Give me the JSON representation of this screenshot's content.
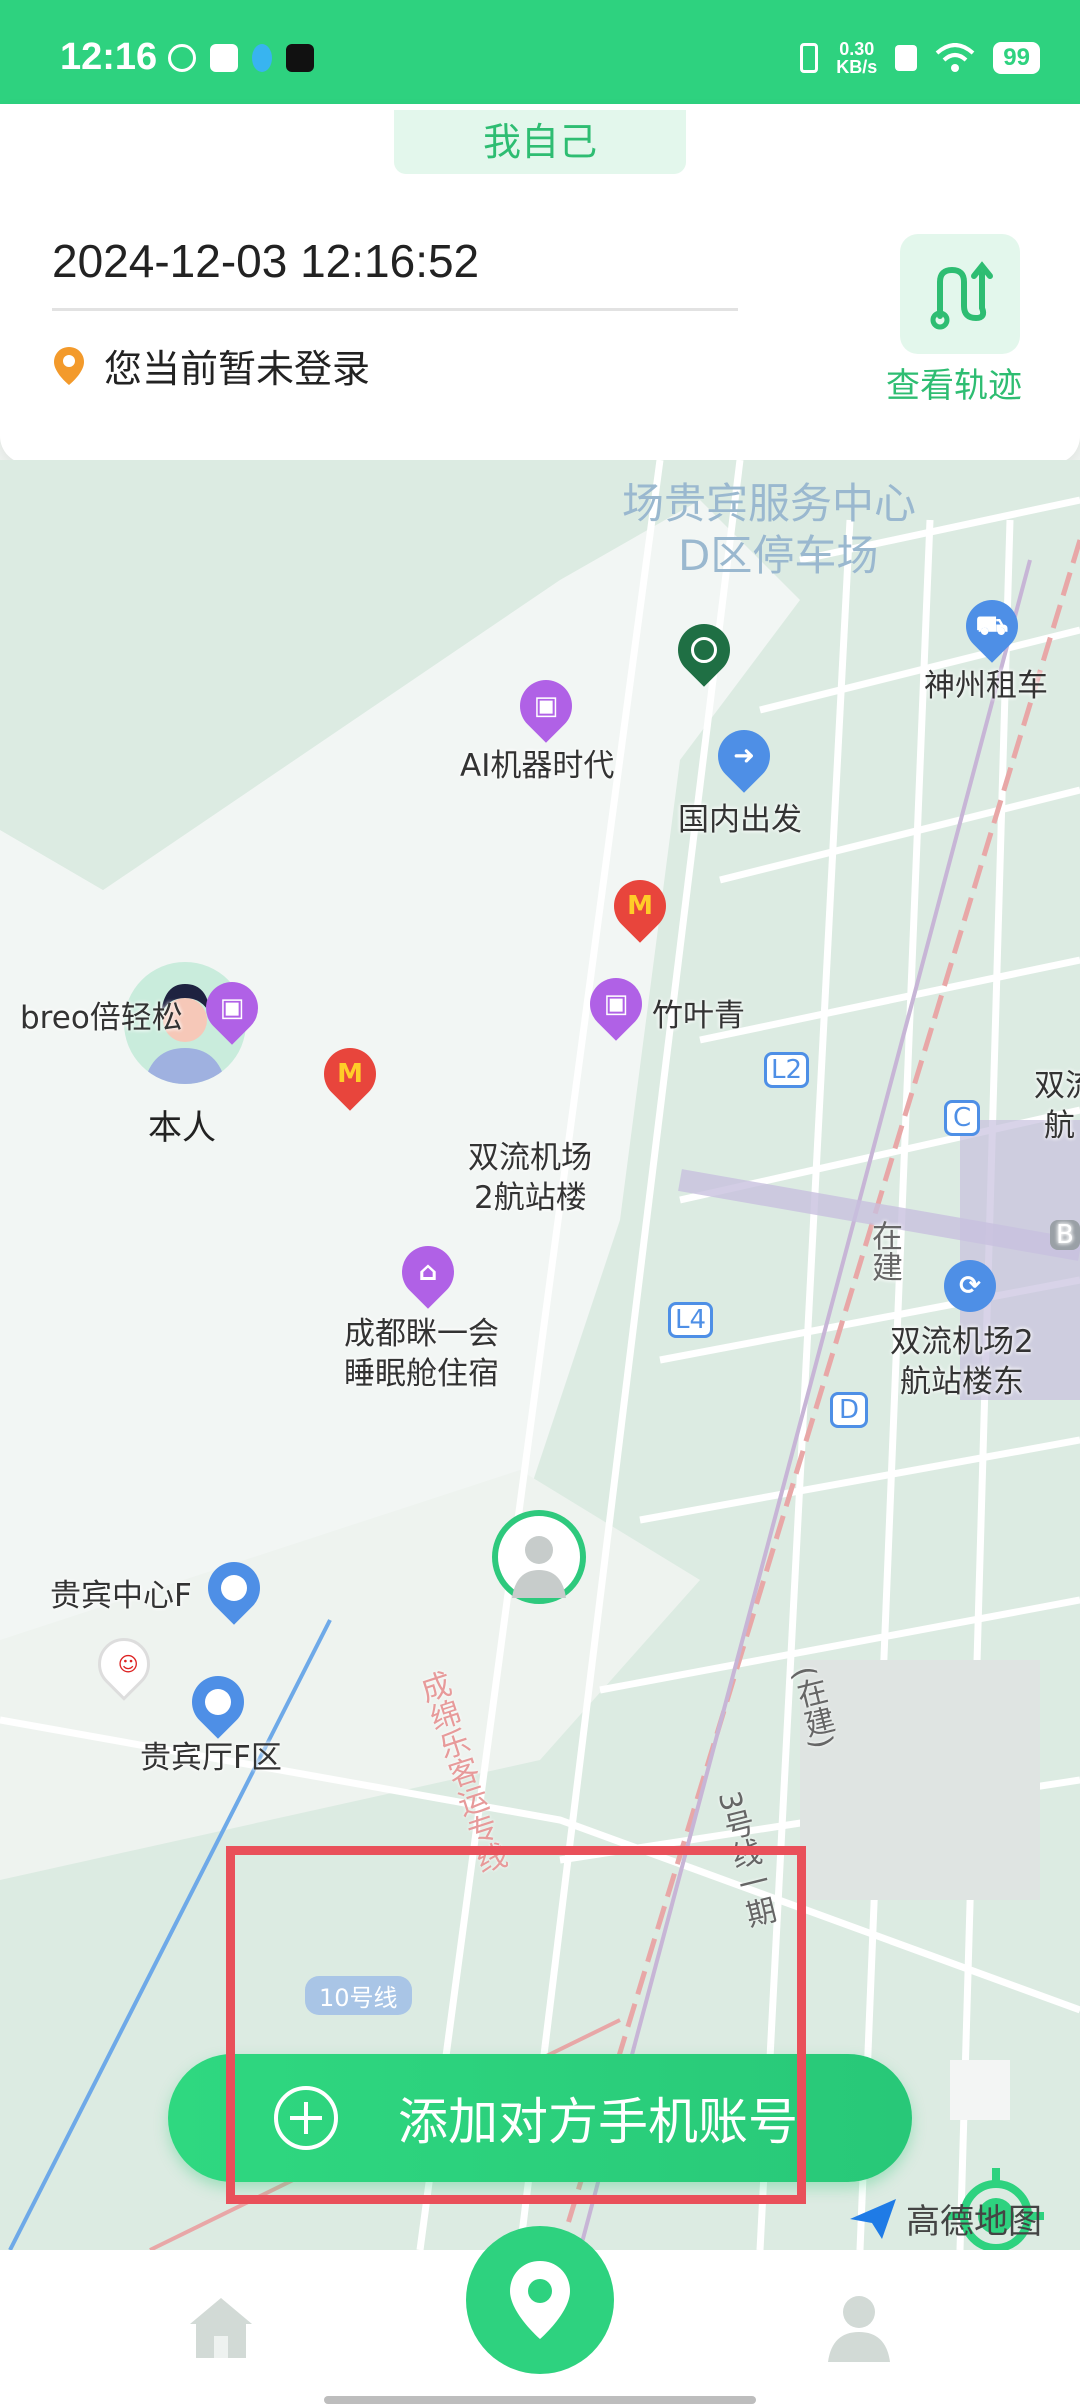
{
  "status_bar": {
    "time": "12:16",
    "net_speed_value": "0.30",
    "net_speed_unit": "KB/s",
    "battery": "99"
  },
  "header": {
    "tab_label": "我自己"
  },
  "info": {
    "datetime": "2024-12-03 12:16:52",
    "login_status": "您当前暂未登录",
    "track_button_label": "查看轨迹"
  },
  "map": {
    "self_avatar_label": "本人",
    "pois": {
      "vip_parking_line1": "场贵宾服务中心",
      "vip_parking_line2": "D区停车场",
      "car_rental": "神州租车",
      "ai_robot": "AI机器时代",
      "domestic_departure": "国内出发",
      "breo": "breo倍轻松",
      "zhuyeqing": "竹叶青",
      "terminal2_line1": "双流机场",
      "terminal2_line2": "2航站楼",
      "capsule_line1": "成都眯一会",
      "capsule_line2": "睡眠舱住宿",
      "vip_center": "贵宾中心F",
      "vip_hall": "贵宾厅F区",
      "terminal2_east_line1": "双流机场2",
      "terminal2_east_line2": "航站楼东",
      "terminal_right_1": "双流",
      "terminal_right_2": "航",
      "construction": "在建",
      "construction_2": "(在建)",
      "metro_line_3": "3号线一期",
      "rail_line": "成绵乐客运专线",
      "line10_badge": "10号线",
      "gate_l2": "L2",
      "gate_l4": "L4",
      "gate_c": "C",
      "gate_d": "D",
      "gate_b": "B"
    },
    "provider": "高德地图"
  },
  "actions": {
    "add_contact": "添加对方手机账号"
  },
  "colors": {
    "brand_green": "#2ed27f",
    "highlight_red": "#e9505a",
    "poi_purple": "#b061e6",
    "poi_blue": "#4e8fe6"
  }
}
